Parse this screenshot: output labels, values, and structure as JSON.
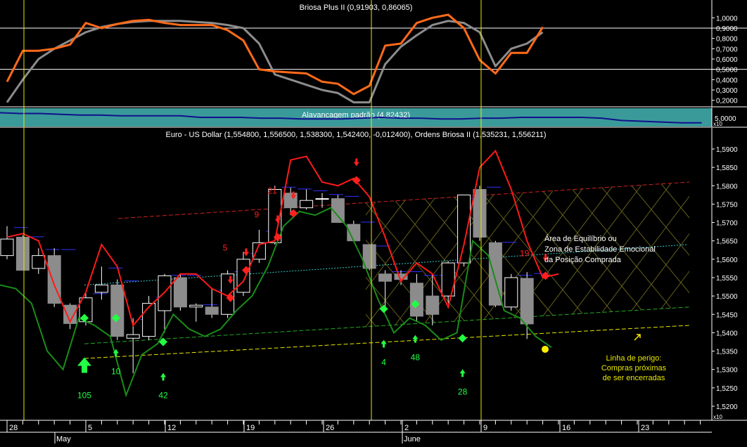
{
  "colors": {
    "background": "#000000",
    "grid_text": "#ffffff",
    "osc_orange": "#ff6a1a",
    "osc_gray": "#8c8c8c",
    "teal_panel": "#3a9a9a",
    "leverage_line": "#10108c",
    "red_line": "#ff1a1a",
    "green_line": "#1a8c1a",
    "bear_candle": "#8c8c8c",
    "bull_candle": "#000000",
    "buy_marker": "#22ff44",
    "sell_marker": "#ff2020",
    "vertical_marker": "#e8e800",
    "danger_line": "#e8e800",
    "upper_channel": "#cc2020",
    "support_channel": "#22aa22",
    "equilibrium_line": "#33cccc"
  },
  "oscillator_panel": {
    "title": "Briosa Plus II (0,91903, 0,86065)",
    "ticks": [
      "1,0000",
      "0,9000",
      "0,8000",
      "0,7000",
      "0,6000",
      "0,5000",
      "0,4000",
      "0,3000",
      "0,2000"
    ],
    "ylim": [
      0.15,
      1.05
    ],
    "ref_lines": [
      0.9,
      0.5
    ]
  },
  "leverage_panel": {
    "title": "Alavancagem padrão (4,82432)",
    "tick": "5,0000",
    "multiplier": "x10"
  },
  "price_panel": {
    "title": "Euro - US Dollar (1,554800, 1,556500, 1,538300, 1,542400, -0,012400), Ordens Briosa II (1,535231, 1,556211)",
    "ticks": [
      "1,5900",
      "1,5850",
      "1,5800",
      "1,5750",
      "1,5700",
      "1,5650",
      "1,5600",
      "1,5550",
      "1,5500",
      "1,5450",
      "1,5400",
      "1,5350",
      "1,5300",
      "1,5250",
      "1,5200"
    ],
    "multiplier": "x10"
  },
  "x_axis": {
    "day_ticks": [
      "28",
      "5",
      "12",
      "19",
      "26",
      "2",
      "9",
      "16",
      "23"
    ],
    "months": [
      "May",
      "June"
    ]
  },
  "annotations": {
    "equilibrium": [
      "Área de Equilíbrio ou",
      "Zona de Estabilidade Emocional",
      "da Posição Comprada"
    ],
    "danger": [
      "Linha de perigo:",
      "Compras próximas",
      "de ser encerradas"
    ],
    "buy_counts": [
      "105",
      "10",
      "42",
      "4",
      "48",
      "28"
    ],
    "sell_counts": [
      "21",
      "9",
      "5",
      "19"
    ]
  },
  "chart_data": [
    {
      "type": "line",
      "title": "Briosa Plus II (0,91903, 0,86065)",
      "ylim": [
        0.15,
        1.05
      ],
      "x_index": [
        0,
        1,
        2,
        3,
        4,
        5,
        6,
        7,
        8,
        9,
        10,
        11,
        12,
        13,
        14,
        15,
        16,
        17,
        18,
        19,
        20,
        21,
        22,
        23,
        24,
        25,
        26,
        27,
        28,
        29,
        30,
        31,
        32,
        33,
        34,
        35,
        36,
        37
      ],
      "series": [
        {
          "values": [
            0.38,
            0.68,
            0.68,
            0.7,
            0.74,
            0.95,
            0.9,
            0.94,
            0.97,
            0.98,
            0.95,
            0.93,
            0.93,
            0.93,
            0.88,
            0.78,
            0.5,
            0.48,
            0.47,
            0.46,
            0.38,
            0.36,
            0.26,
            0.34,
            0.73,
            0.75,
            0.95,
            1.0,
            1.03,
            0.9,
            0.59,
            0.46,
            0.66,
            0.66,
            0.91
          ]
        },
        {
          "values": [
            0.18,
            0.4,
            0.6,
            0.7,
            0.78,
            0.86,
            0.91,
            0.94,
            0.96,
            0.97,
            0.97,
            0.97,
            0.96,
            0.95,
            0.93,
            0.9,
            0.75,
            0.45,
            0.4,
            0.35,
            0.3,
            0.27,
            0.18,
            0.18,
            0.55,
            0.72,
            0.83,
            0.93,
            0.97,
            0.95,
            0.86,
            0.53,
            0.7,
            0.75,
            0.86
          ]
        }
      ]
    },
    {
      "type": "line",
      "title": "Alavancagem padrão (4,82432)",
      "series": [
        {
          "values": [
            0.2,
            0.25,
            0.25,
            0.3,
            0.35,
            0.35,
            0.4,
            0.4,
            0.4,
            0.4,
            0.5,
            0.5,
            0.5,
            0.55,
            0.55,
            0.6,
            0.6,
            0.6,
            0.55,
            0.5,
            0.55,
            0.55,
            0.6,
            0.6,
            0.55,
            0.55,
            0.5,
            0.5,
            0.5,
            0.5,
            0.55,
            0.7,
            0.75,
            0.8,
            0.85,
            0.85
          ]
        }
      ]
    },
    {
      "type": "candlestick",
      "title": "Euro - US Dollar (1,554800, 1,556500, 1,538300, 1,542400, -0,012400), Ordens Briosa II (1,535231, 1,556211)",
      "ylim": [
        1.518,
        1.5935
      ],
      "x_axis_days": [
        "28",
        "5",
        "12",
        "19",
        "26",
        "2",
        "9",
        "16",
        "23"
      ],
      "candles": [
        {
          "o": 1.561,
          "h": 1.569,
          "l": 1.56,
          "c": 1.5655
        },
        {
          "o": 1.566,
          "h": 1.5665,
          "l": 1.557,
          "c": 1.557
        },
        {
          "o": 1.5575,
          "h": 1.563,
          "l": 1.556,
          "c": 1.561
        },
        {
          "o": 1.561,
          "h": 1.563,
          "l": 1.547,
          "c": 1.548
        },
        {
          "o": 1.5475,
          "h": 1.548,
          "l": 1.541,
          "c": 1.5425
        },
        {
          "o": 1.543,
          "h": 1.551,
          "l": 1.542,
          "c": 1.5495
        },
        {
          "o": 1.551,
          "h": 1.558,
          "l": 1.549,
          "c": 1.553
        },
        {
          "o": 1.553,
          "h": 1.5545,
          "l": 1.538,
          "c": 1.539
        },
        {
          "o": 1.5385,
          "h": 1.544,
          "l": 1.529,
          "c": 1.5395
        },
        {
          "o": 1.539,
          "h": 1.55,
          "l": 1.538,
          "c": 1.548
        },
        {
          "o": 1.546,
          "h": 1.556,
          "l": 1.54,
          "c": 1.5555
        },
        {
          "o": 1.555,
          "h": 1.556,
          "l": 1.546,
          "c": 1.547
        },
        {
          "o": 1.547,
          "h": 1.548,
          "l": 1.543,
          "c": 1.5475
        },
        {
          "o": 1.547,
          "h": 1.552,
          "l": 1.544,
          "c": 1.545
        },
        {
          "o": 1.545,
          "h": 1.557,
          "l": 1.544,
          "c": 1.556
        },
        {
          "o": 1.551,
          "h": 1.562,
          "l": 1.55,
          "c": 1.56
        },
        {
          "o": 1.56,
          "h": 1.568,
          "l": 1.559,
          "c": 1.5645
        },
        {
          "o": 1.5645,
          "h": 1.58,
          "l": 1.564,
          "c": 1.579
        },
        {
          "o": 1.578,
          "h": 1.5795,
          "l": 1.572,
          "c": 1.574
        },
        {
          "o": 1.574,
          "h": 1.579,
          "l": 1.5735,
          "c": 1.576
        },
        {
          "o": 1.5765,
          "h": 1.578,
          "l": 1.574,
          "c": 1.5765
        },
        {
          "o": 1.5765,
          "h": 1.5775,
          "l": 1.57,
          "c": 1.57
        },
        {
          "o": 1.5695,
          "h": 1.5705,
          "l": 1.565,
          "c": 1.565
        },
        {
          "o": 1.564,
          "h": 1.564,
          "l": 1.557,
          "c": 1.5575
        },
        {
          "o": 1.556,
          "h": 1.557,
          "l": 1.547,
          "c": 1.554
        },
        {
          "o": 1.556,
          "h": 1.557,
          "l": 1.553,
          "c": 1.5545
        },
        {
          "o": 1.5535,
          "h": 1.556,
          "l": 1.543,
          "c": 1.5445
        },
        {
          "o": 1.55,
          "h": 1.556,
          "l": 1.542,
          "c": 1.545
        },
        {
          "o": 1.55,
          "h": 1.5595,
          "l": 1.548,
          "c": 1.559
        },
        {
          "o": 1.559,
          "h": 1.577,
          "l": 1.558,
          "c": 1.5775
        },
        {
          "o": 1.579,
          "h": 1.58,
          "l": 1.565,
          "c": 1.566
        },
        {
          "o": 1.5645,
          "h": 1.565,
          "l": 1.547,
          "c": 1.5475
        },
        {
          "o": 1.547,
          "h": 1.556,
          "l": 1.546,
          "c": 1.555
        },
        {
          "o": 1.5548,
          "h": 1.5565,
          "l": 1.5383,
          "c": 1.5424
        }
      ],
      "upper_line": [
        1.566,
        1.567,
        1.565,
        1.553,
        1.543,
        1.551,
        1.564,
        1.558,
        1.542,
        1.547,
        1.551,
        1.556,
        1.556,
        1.552,
        1.55,
        1.554,
        1.564,
        1.565,
        1.587,
        1.588,
        1.581,
        1.58,
        1.582,
        1.577,
        1.566,
        1.554,
        1.559,
        1.556,
        1.547,
        1.564,
        1.585,
        1.5895,
        1.579,
        1.565,
        1.555,
        1.556
      ],
      "lower_line": [
        1.553,
        1.552,
        1.548,
        1.535,
        1.53,
        1.544,
        1.542,
        1.539,
        1.523,
        1.534,
        1.537,
        1.545,
        1.541,
        1.539,
        1.541,
        1.546,
        1.55,
        1.558,
        1.569,
        1.573,
        1.572,
        1.574,
        1.569,
        1.56,
        1.549,
        1.54,
        1.544,
        1.542,
        1.538,
        1.54,
        1.565,
        1.561,
        1.546,
        1.544,
        1.539,
        1.536
      ],
      "buy_signals": [
        {
          "i": 5,
          "price": 1.544,
          "count": "105"
        },
        {
          "i": 7,
          "price": 1.544,
          "count": "10"
        },
        {
          "i": 10,
          "price": 1.5375,
          "count": "42"
        },
        {
          "i": 24,
          "price": 1.5465,
          "count": "4"
        },
        {
          "i": 26,
          "price": 1.5478,
          "count": "48"
        },
        {
          "i": 29,
          "price": 1.5385,
          "count": "28"
        }
      ],
      "sell_signals": [
        {
          "i": 14,
          "price": 1.5495,
          "count": ""
        },
        {
          "i": 15,
          "price": 1.557,
          "count": "5"
        },
        {
          "i": 17,
          "price": 1.566,
          "count": "9"
        },
        {
          "i": 18,
          "price": 1.5725,
          "count": "21"
        },
        {
          "i": 22,
          "price": 1.5815,
          "count": ""
        },
        {
          "i": 34,
          "price": 1.5555,
          "count": "19"
        }
      ],
      "channels": {
        "upper_red": {
          "from": 1.5705,
          "to": 1.581
        },
        "equilibrium_cyan": {
          "from": 1.553,
          "to": 1.564
        },
        "support_green": {
          "from": 1.537,
          "to": 1.547
        },
        "danger_yellow": {
          "from": 1.533,
          "to": 1.542
        }
      },
      "last_close_marker": 1.5355
    }
  ]
}
